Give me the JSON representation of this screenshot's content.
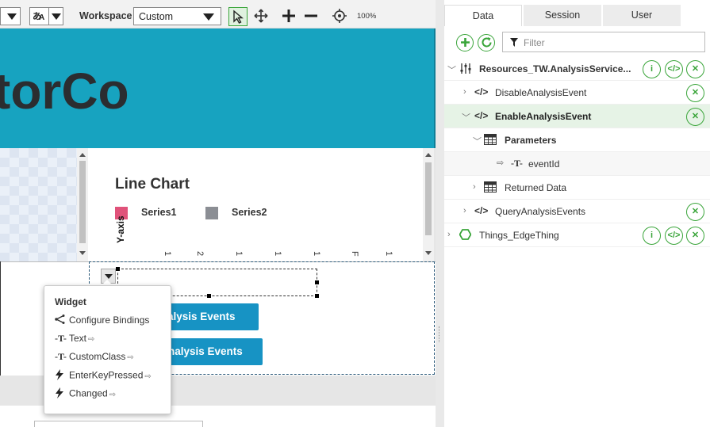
{
  "toolbar": {
    "workspace_label": "Workspace",
    "workspace_value": "Custom",
    "zoom": "100%",
    "icons": [
      "layout-select-icon",
      "language-icon",
      "select-pointer-icon",
      "move-icon",
      "zoom-in-icon",
      "zoom-out-icon",
      "fit-target-icon"
    ]
  },
  "canvas": {
    "banner_text": "torCo",
    "chart": {
      "title": "Line Chart",
      "series1": "Series1",
      "series2": "Series2",
      "y_axis_label": "Y-axis",
      "ticks": [
        "1",
        "2",
        "1",
        "1",
        "1",
        "F",
        "1"
      ],
      "series1_color": "#e0527a",
      "series2_color": "#8b8e94"
    },
    "button1": "alysis Events",
    "button2": "nalysis Events"
  },
  "context_menu": {
    "title": "Widget",
    "items": [
      {
        "label": "Configure Bindings",
        "icon": "bindings-icon",
        "arrow": ""
      },
      {
        "label": "Text",
        "icon": "text-icon",
        "arrow": "⇨"
      },
      {
        "label": "CustomClass",
        "icon": "text-icon",
        "arrow": "⇨"
      },
      {
        "label": "EnterKeyPressed",
        "icon": "event-bolt-icon",
        "arrow": "⇨"
      },
      {
        "label": "Changed",
        "icon": "event-bolt-icon",
        "arrow": "⇨"
      }
    ]
  },
  "right_panel": {
    "tabs": [
      "Data",
      "Session",
      "User"
    ],
    "active_tab": "Data",
    "filter_placeholder": "Filter",
    "tree": {
      "root": "Resources_TW.AnalysisService...",
      "services": [
        "DisableAnalysisEvent",
        "EnableAnalysisEvent"
      ],
      "parameters": "Parameters",
      "param_item": "eventId",
      "returned_data": "Returned Data",
      "query": "QueryAnalysisEvents",
      "thing": "Things_EdgeThing"
    },
    "accent_color": "#3aa53a"
  }
}
